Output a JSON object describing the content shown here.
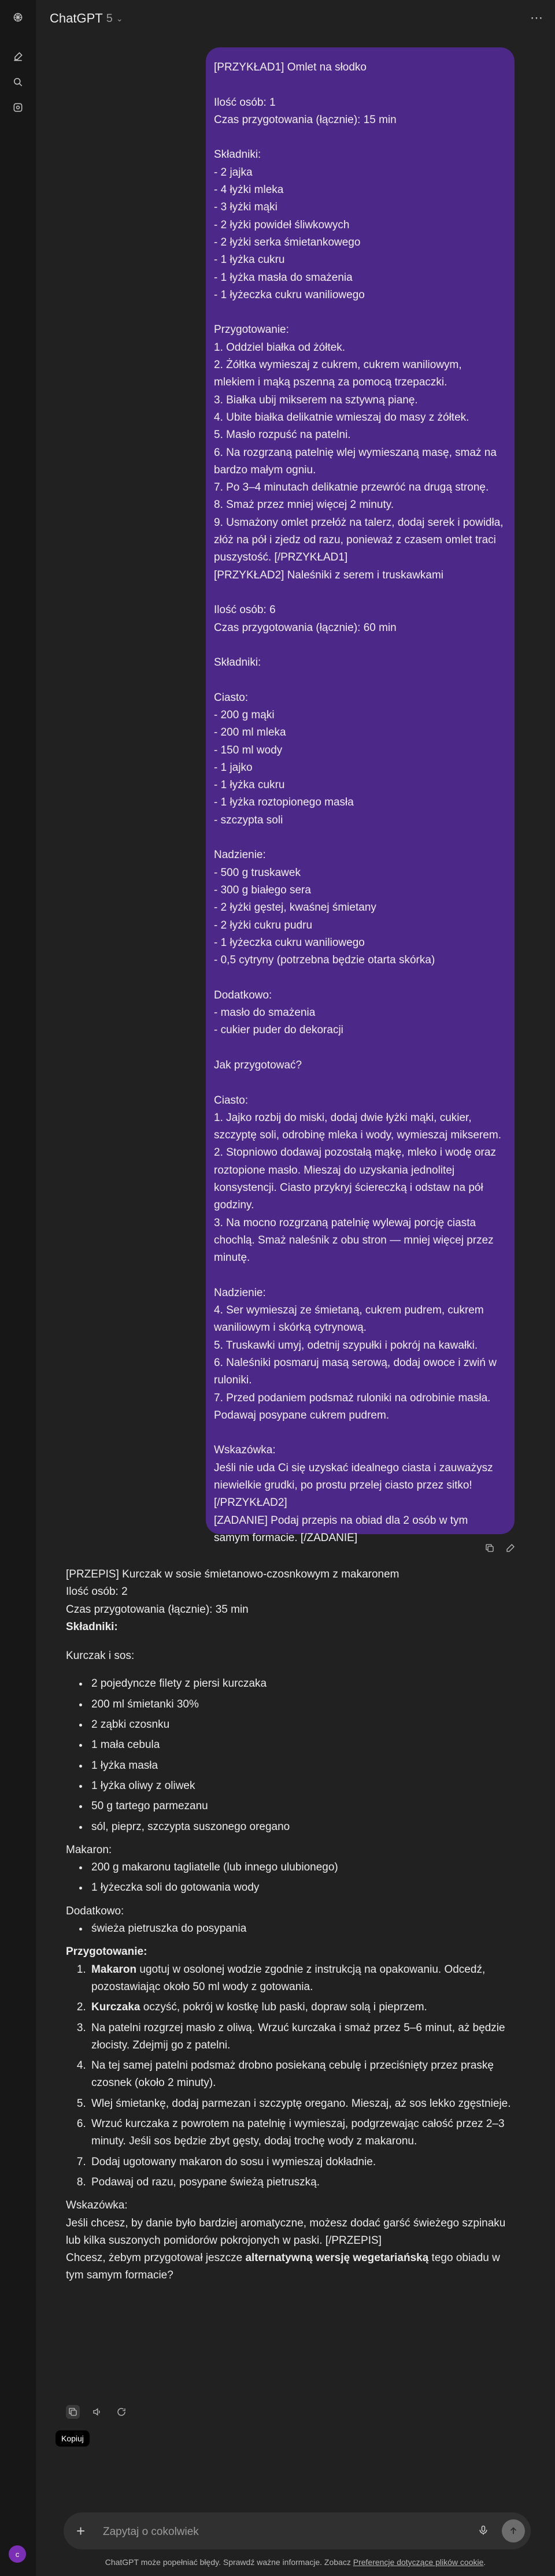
{
  "header": {
    "model_name": "ChatGPT",
    "model_version": "5"
  },
  "user_message": "[PRZYKŁAD1] Omlet na słodko\n\nIlość osób: 1\nCzas przygotowania (łącznie): 15 min\n\nSkładniki:\n- 2 jajka\n- 4 łyżki mleka\n- 3 łyżki mąki\n- 2 łyżki powideł śliwkowych\n- 2 łyżki serka śmietankowego\n- 1 łyżka cukru\n- 1 łyżka masła do smażenia\n- 1 łyżeczka cukru waniliowego\n\nPrzygotowanie:\n1. Oddziel białka od żółtek.\n2. Żółtka wymieszaj z cukrem, cukrem waniliowym, mlekiem i mąką pszenną za pomocą trzepaczki.\n3. Białka ubij mikserem na sztywną pianę.\n4. Ubite białka delikatnie wmieszaj do masy z żółtek.\n5. Masło rozpuść na patelni.\n6. Na rozgrzaną patelnię wlej wymieszaną masę, smaż na bardzo małym ogniu.\n7. Po 3–4 minutach delikatnie przewróć na drugą stronę.\n8. Smaż przez mniej więcej 2 minuty.\n9. Usmażony omlet przełóż na talerz, dodaj serek i powidła, złóż na pół i zjedz od razu, ponieważ z czasem omlet traci puszystość. [/PRZYKŁAD1]\n[PRZYKŁAD2] Naleśniki z serem i truskawkami\n\nIlość osób: 6\nCzas przygotowania (łącznie): 60 min\n\nSkładniki:\n\nCiasto:\n- 200 g mąki\n- 200 ml mleka\n- 150 ml wody\n- 1 jajko\n- 1 łyżka cukru\n- 1 łyżka roztopionego masła\n- szczypta soli\n\nNadzienie:\n- 500 g truskawek\n- 300 g białego sera\n- 2 łyżki gęstej, kwaśnej śmietany\n- 2 łyżki cukru pudru\n- 1 łyżeczka cukru waniliowego\n- 0,5 cytryny (potrzebna będzie otarta skórka)\n\nDodatkowo:\n- masło do smażenia\n- cukier puder do dekoracji\n\nJak przygotować?\n\nCiasto:\n1. Jajko rozbij do miski, dodaj dwie łyżki mąki, cukier, szczyptę soli, odrobinę mleka i wody, wymieszaj mikserem.\n2. Stopniowo dodawaj pozostałą mąkę, mleko i wodę oraz roztopione masło. Mieszaj do uzyskania jednolitej konsystencji. Ciasto przykryj ściereczką i odstaw na pół godziny.\n3. Na mocno rozgrzaną patelnię wylewaj porcję ciasta chochlą. Smaż naleśnik z obu stron — mniej więcej przez minutę.\n\nNadzienie:\n4. Ser wymieszaj ze śmietaną, cukrem pudrem, cukrem waniliowym i skórką cytrynową.\n5. Truskawki umyj, odetnij szypułki i pokrój na kawałki.\n6. Naleśniki posmaruj masą serową, dodaj owoce i zwiń w ruloniki.\n7. Przed podaniem podsmaż ruloniki na odrobinie masła. Podawaj posypane cukrem pudrem.\n\nWskazówka:\nJeśli nie uda Ci się uzyskać idealnego ciasta i zauważysz niewielkie grudki, po prostu przelej ciasto przez sitko! [/PRZYKŁAD2]\n[ZADANIE] Podaj przepis na obiad dla 2 osób w tym samym formacie. [/ZADANIE]",
  "assistant": {
    "title": "[PRZEPIS] Kurczak w sosie śmietanowo-czosnkowym z makaronem",
    "servings": "Ilość osób: 2",
    "prep_time": "Czas przygotowania (łącznie): 35 min",
    "ingredients_heading": "Składniki:",
    "sauce_heading": "Kurczak i sos:",
    "sauce_items": [
      "2 pojedyncze filety z piersi kurczaka",
      "200 ml śmietanki 30%",
      "2 ząbki czosnku",
      "1 mała cebula",
      "1 łyżka masła",
      "1 łyżka oliwy z oliwek",
      "50 g tartego parmezanu",
      "sól, pieprz, szczypta suszonego oregano"
    ],
    "pasta_heading": "Makaron:",
    "pasta_items": [
      "200 g makaronu tagliatelle (lub innego ulubionego)",
      "1 łyżeczka soli do gotowania wody"
    ],
    "extra_heading": "Dodatkowo:",
    "extra_items": [
      "świeża pietruszka do posypania"
    ],
    "prep_heading": "Przygotowanie:",
    "steps": [
      {
        "b": "Makaron",
        "t": " ugotuj w osolonej wodzie zgodnie z instrukcją na opakowaniu. Odcedź, pozostawiając około 50 ml wody z gotowania."
      },
      {
        "b": "Kurczaka",
        "t": " oczyść, pokrój w kostkę lub paski, dopraw solą i pieprzem."
      },
      {
        "b": "",
        "t": "Na patelni rozgrzej masło z oliwą. Wrzuć kurczaka i smaż przez 5–6 minut, aż będzie złocisty. Zdejmij go z patelni."
      },
      {
        "b": "",
        "t": "Na tej samej patelni podsmaż drobno posiekaną cebulę i przeciśnięty przez praskę czosnek (około 2 minuty)."
      },
      {
        "b": "",
        "t": "Wlej śmietankę, dodaj parmezan i szczyptę oregano. Mieszaj, aż sos lekko zgęstnieje."
      },
      {
        "b": "",
        "t": "Wrzuć kurczaka z powrotem na patelnię i wymieszaj, podgrzewając całość przez 2–3 minuty. Jeśli sos będzie zbyt gęsty, dodaj trochę wody z makaronu."
      },
      {
        "b": "",
        "t": "Dodaj ugotowany makaron do sosu i wymieszaj dokładnie."
      },
      {
        "b": "",
        "t": "Podawaj od razu, posypane świeżą pietruszką."
      }
    ],
    "tip_heading": "Wskazówka:",
    "tip_text": "Jeśli chcesz, by danie było bardziej aromatyczne, możesz dodać garść świeżego szpinaku lub kilka suszonych pomidorów pokrojonych w paski. [/PRZEPIS]",
    "question_pre": "Chcesz, żebym przygotował jeszcze ",
    "question_bold": "alternatywną wersję wegetariańską",
    "question_post": " tego obiadu w tym samym formacie?",
    "copy_tooltip": "Kopiuj"
  },
  "composer": {
    "placeholder": "Zapytaj o cokolwiek"
  },
  "footer": {
    "text": "ChatGPT może popełniać błędy. Sprawdź ważne informacje. Zobacz ",
    "link": "Preferencje dotyczące plików cookie",
    "end": "."
  },
  "user_avatar_initial": "c",
  "colors": {
    "user_bubble": "#4c2889",
    "background": "#212121",
    "rail": "#171717",
    "avatar": "#7b2fb4"
  },
  "icons": [
    "chatgpt-logo-icon",
    "new-chat-icon",
    "search-icon",
    "library-icon",
    "chevron-down-icon",
    "more-icon",
    "copy-icon",
    "edit-icon",
    "speaker-icon",
    "regenerate-icon",
    "plus-icon",
    "mic-icon",
    "voice-icon"
  ]
}
